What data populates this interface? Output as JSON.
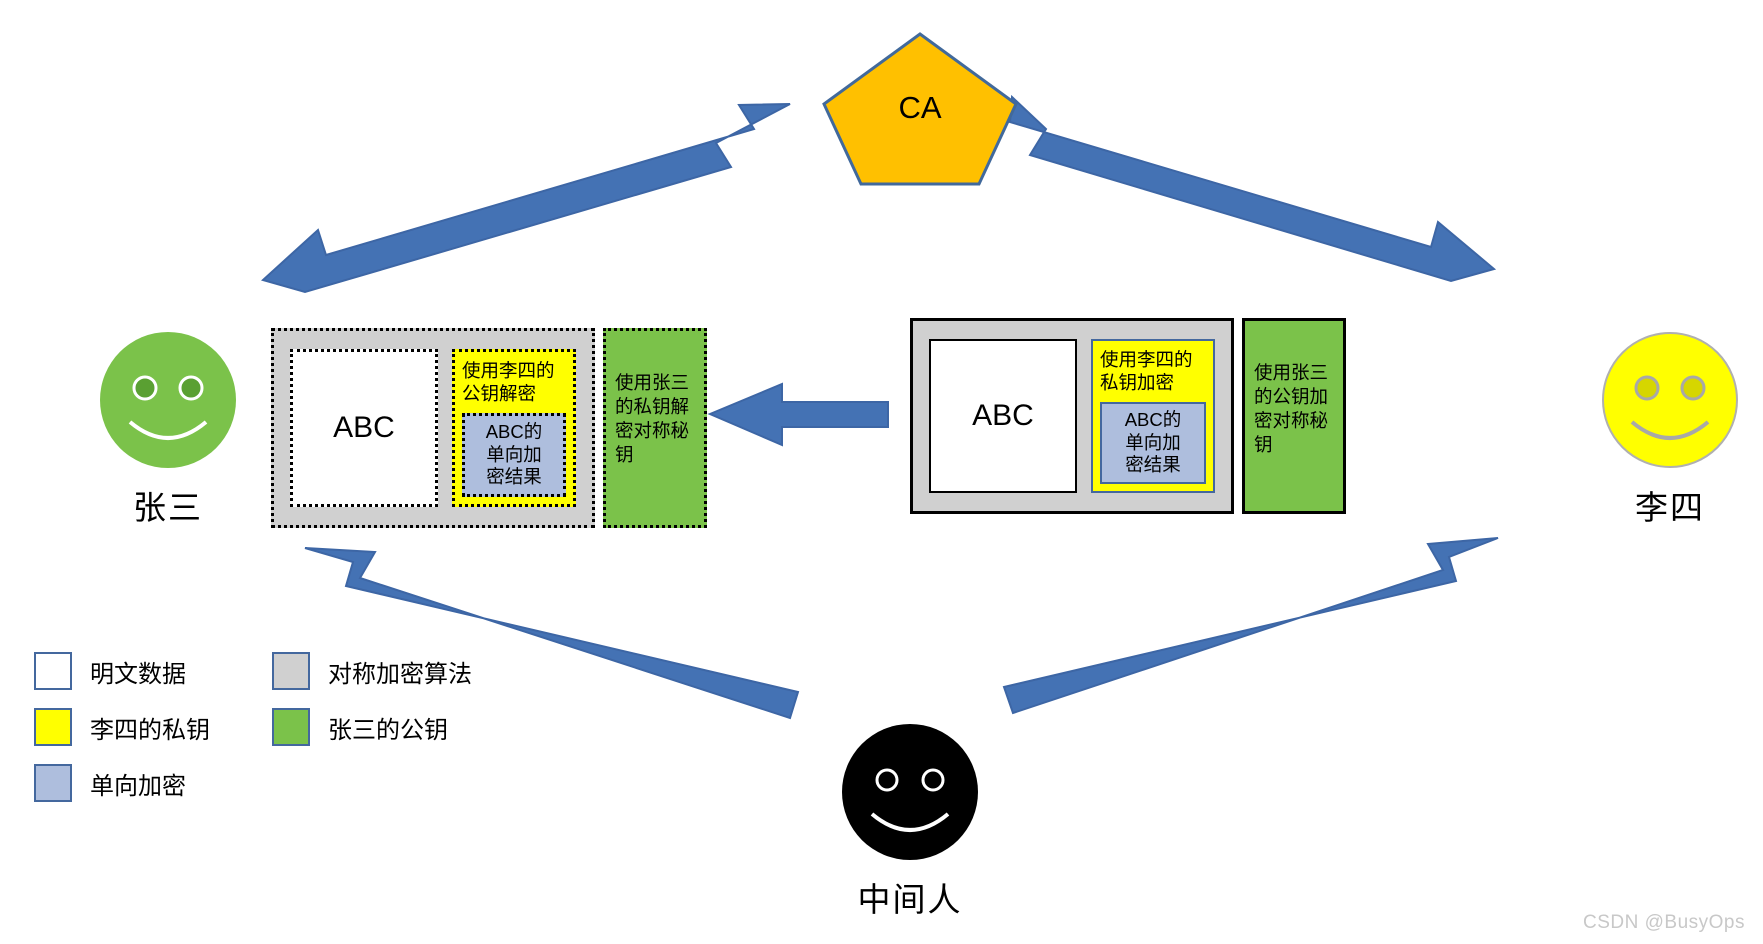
{
  "diagram": {
    "ca": {
      "label": "CA",
      "fill": "#ffc000",
      "stroke": "#41699b"
    },
    "actors": {
      "zhangsan": {
        "name": "张三",
        "face_color": "#7bc24a",
        "role": "receiver"
      },
      "lisi": {
        "name": "李四",
        "face_color": "#ffff00",
        "role": "sender"
      },
      "mitm": {
        "name": "中间人",
        "face_color": "#000000",
        "role": "man-in-the-middle"
      }
    },
    "left_block": {
      "symmetric_label": "",
      "plaintext": "ABC",
      "key_box": {
        "line1": "使用李四的",
        "line2": "公钥解密"
      },
      "hash_box": {
        "line1": "ABC的",
        "line2": "单向加",
        "line3": "密结果"
      },
      "pubkey_box": {
        "line1": "使用张三",
        "line2": "的私钥解",
        "line3": "密对称秘",
        "line4": "钥"
      }
    },
    "right_block": {
      "plaintext": "ABC",
      "key_box": {
        "line1": "使用李四的",
        "line2": "私钥加密"
      },
      "hash_box": {
        "line1": "ABC的",
        "line2": "单向加",
        "line3": "密结果"
      },
      "pubkey_box": {
        "line1": "使用张三",
        "line2": "的公钥加",
        "line3": "密对称秘",
        "line4": "钥"
      }
    },
    "legend": {
      "items": [
        {
          "label": "明文数据",
          "color": "#ffffff"
        },
        {
          "label": "对称加密算法",
          "color": "#d0d0d0"
        },
        {
          "label": "李四的私钥",
          "color": "#ffff00"
        },
        {
          "label": "张三的公钥",
          "color": "#7bc24a"
        },
        {
          "label": "单向加密",
          "color": "#aebedd"
        },
        {
          "label": "",
          "color": ""
        }
      ]
    },
    "arrows": {
      "color": "#4472b4",
      "list": [
        {
          "name": "ca-to-zhangsan"
        },
        {
          "name": "ca-to-lisi"
        },
        {
          "name": "lisi-to-zhangsan"
        },
        {
          "name": "mitm-to-zhangsan"
        },
        {
          "name": "mitm-to-lisi"
        }
      ]
    },
    "watermark": "CSDN @BusyOps"
  }
}
